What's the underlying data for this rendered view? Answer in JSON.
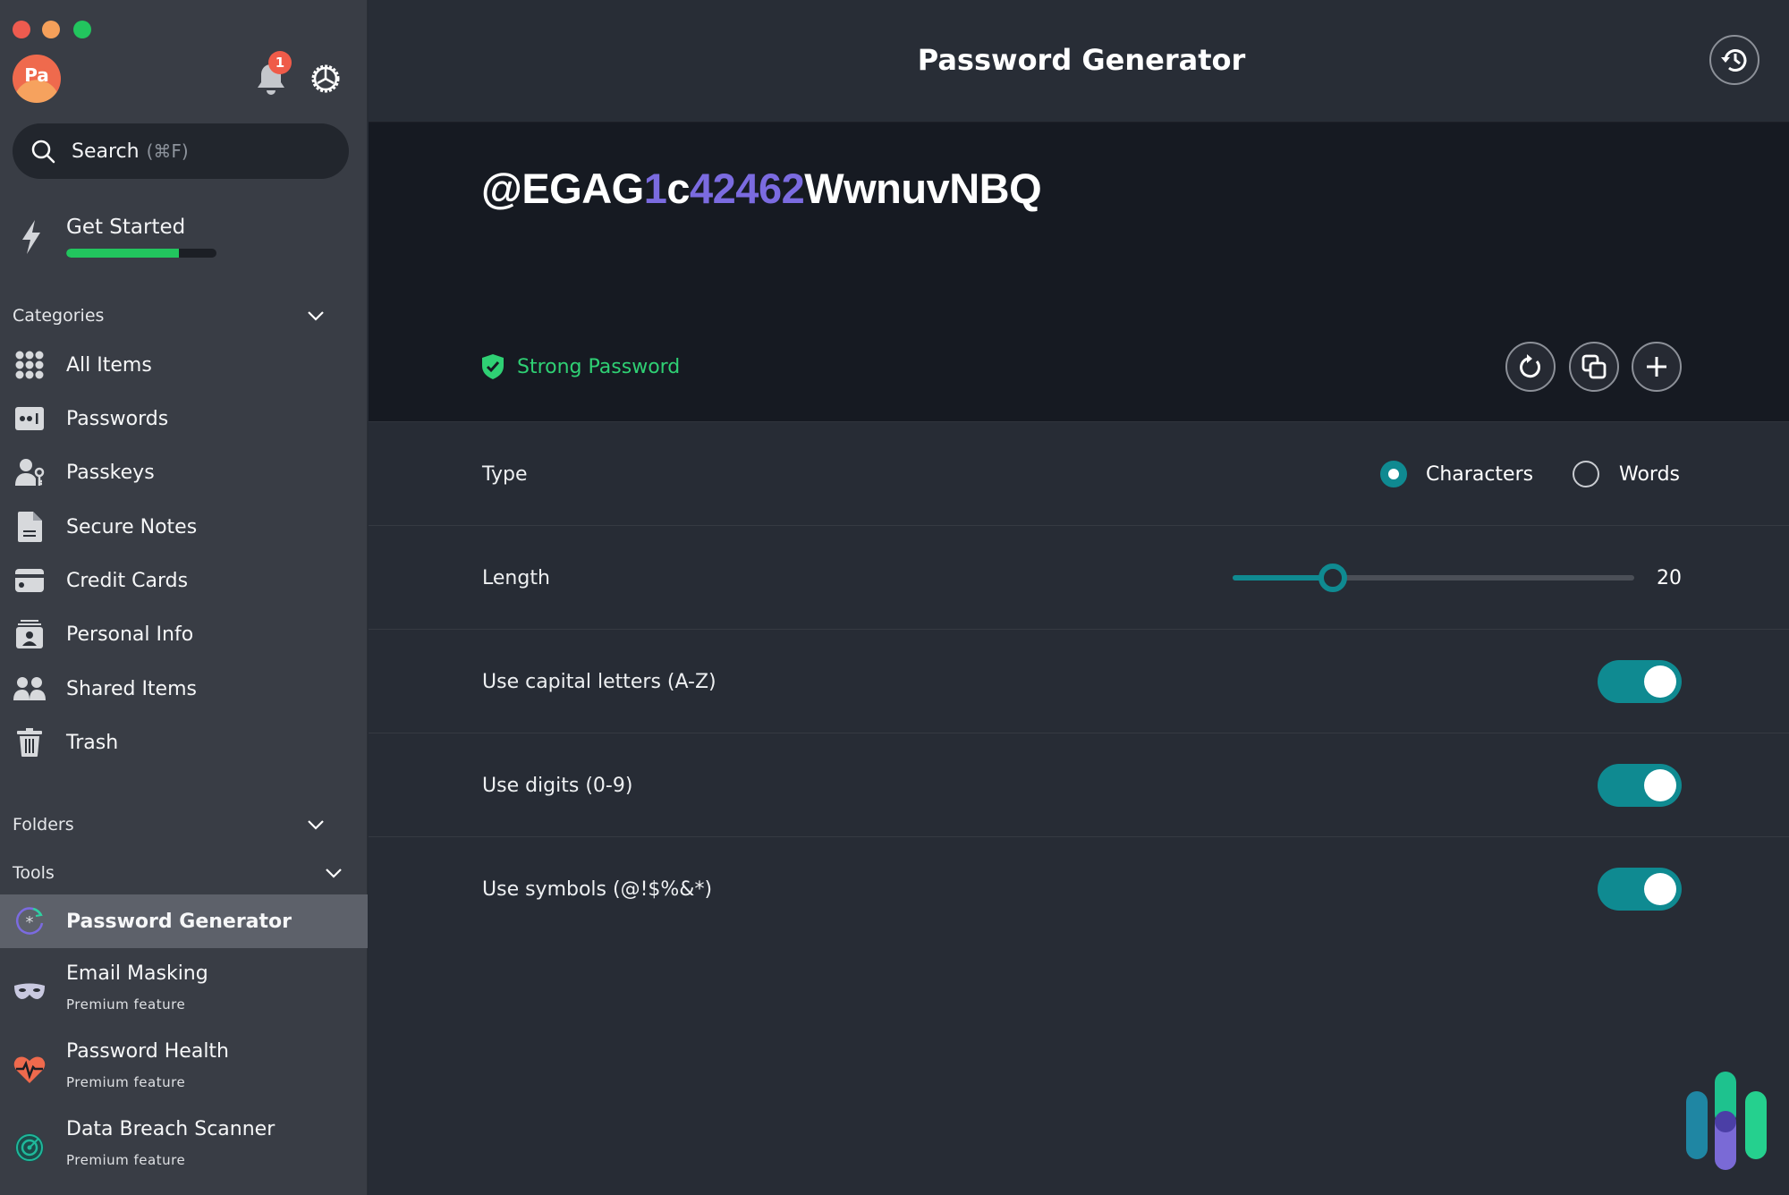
{
  "window": {
    "controls": [
      "close",
      "minimize",
      "maximize"
    ]
  },
  "sidebar": {
    "avatar_initials": "Pa",
    "notifications_count": "1",
    "search": {
      "label": "Search",
      "shortcut": "(⌘F)"
    },
    "get_started": {
      "label": "Get Started",
      "progress_fraction": 0.75
    },
    "categories": {
      "header": "Categories",
      "items": [
        {
          "label": "All Items",
          "icon": "grid-icon"
        },
        {
          "label": "Passwords",
          "icon": "password-field-icon"
        },
        {
          "label": "Passkeys",
          "icon": "passkey-user-icon"
        },
        {
          "label": "Secure Notes",
          "icon": "note-icon"
        },
        {
          "label": "Credit Cards",
          "icon": "credit-card-icon"
        },
        {
          "label": "Personal Info",
          "icon": "id-card-icon"
        },
        {
          "label": "Shared Items",
          "icon": "users-icon"
        },
        {
          "label": "Trash",
          "icon": "trash-icon"
        }
      ]
    },
    "folders": {
      "header": "Folders"
    },
    "tools": {
      "header": "Tools",
      "items": [
        {
          "label": "Password Generator",
          "icon": "password-generator-icon",
          "active": true
        },
        {
          "label": "Email Masking",
          "sub": "Premium feature",
          "icon": "mask-icon"
        },
        {
          "label": "Password Health",
          "sub": "Premium feature",
          "icon": "heart-pulse-icon"
        },
        {
          "label": "Data Breach Scanner",
          "sub": "Premium feature",
          "icon": "radar-icon"
        }
      ]
    }
  },
  "main": {
    "title": "Password Generator",
    "password": {
      "segments": [
        {
          "text": "@EGAG",
          "kind": "char"
        },
        {
          "text": "1",
          "kind": "digit"
        },
        {
          "text": "c",
          "kind": "char"
        },
        {
          "text": "42462",
          "kind": "digit"
        },
        {
          "text": "WwnuvNBQ",
          "kind": "char"
        }
      ],
      "strength": "Strong Password"
    },
    "options": {
      "type": {
        "label": "Type",
        "choices": [
          "Characters",
          "Words"
        ],
        "selected": "Characters"
      },
      "length": {
        "label": "Length",
        "value": "20",
        "slider_fraction": 0.25
      },
      "capital": {
        "label": "Use capital letters (A-Z)",
        "enabled": true
      },
      "digits": {
        "label": "Use digits (0-9)",
        "enabled": true
      },
      "symbols": {
        "label": "Use symbols (@!$%&*)",
        "enabled": true
      }
    }
  },
  "colors": {
    "accent": "#0f8a91",
    "strong": "#2fd074",
    "digit": "#7b6be0",
    "progress": "#22c55e",
    "badge": "#ef5b49"
  }
}
